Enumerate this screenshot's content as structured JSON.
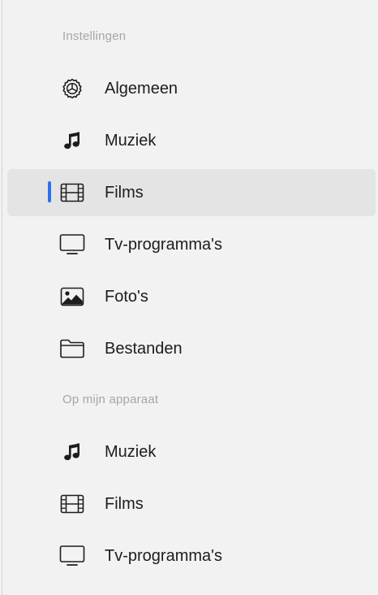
{
  "sidebar": {
    "sections": [
      {
        "header": "Instellingen",
        "items": [
          {
            "label": "Algemeen",
            "icon": "gear-icon"
          },
          {
            "label": "Muziek",
            "icon": "music-note-icon"
          },
          {
            "label": "Films",
            "icon": "film-icon",
            "selected": true
          },
          {
            "label": "Tv-programma's",
            "icon": "tv-icon"
          },
          {
            "label": "Foto's",
            "icon": "photo-icon"
          },
          {
            "label": "Bestanden",
            "icon": "folder-icon"
          }
        ]
      },
      {
        "header": "Op mijn apparaat",
        "items": [
          {
            "label": "Muziek",
            "icon": "music-note-icon"
          },
          {
            "label": "Films",
            "icon": "film-icon"
          },
          {
            "label": "Tv-programma's",
            "icon": "tv-icon"
          }
        ]
      }
    ]
  },
  "colors": {
    "background": "#f2f2f2",
    "selected_background": "#e4e4e4",
    "accent": "#2d6ff0",
    "header_text": "#a6a6a6",
    "text": "#1d1d1f"
  }
}
